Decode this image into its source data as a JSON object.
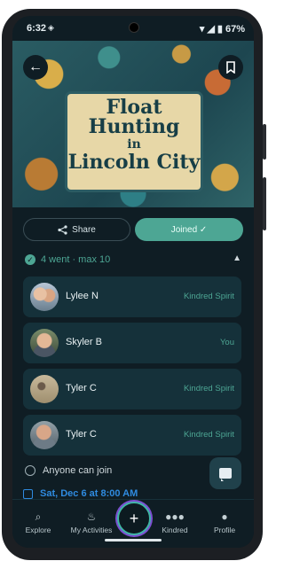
{
  "status": {
    "time": "6:32",
    "battery": "67%"
  },
  "event": {
    "title_line1": "Float Hunting",
    "title_line2": "in",
    "title_line3": "Lincoln City"
  },
  "actions": {
    "share_label": "Share",
    "joined_label": "Joined ✓"
  },
  "attendance": {
    "summary": "4 went · max 10"
  },
  "members": [
    {
      "name": "Lylee N",
      "tag": "Kindred Spirit"
    },
    {
      "name": "Skyler B",
      "tag": "You"
    },
    {
      "name": "Tyler C",
      "tag": "Kindred Spirit"
    },
    {
      "name": "Tyler C",
      "tag": "Kindred Spirit"
    }
  ],
  "details": {
    "visibility": "Anyone can join",
    "date": "Sat, Dec 6 at 8:00 AM"
  },
  "nav": {
    "explore": "Explore",
    "activities": "My Activities",
    "kindred": "Kindred",
    "profile": "Profile",
    "center_icon": "plus-icon"
  },
  "colors": {
    "accent": "#4da694",
    "background": "#0f1d24",
    "card": "#15313a",
    "date": "#2f8be0"
  }
}
